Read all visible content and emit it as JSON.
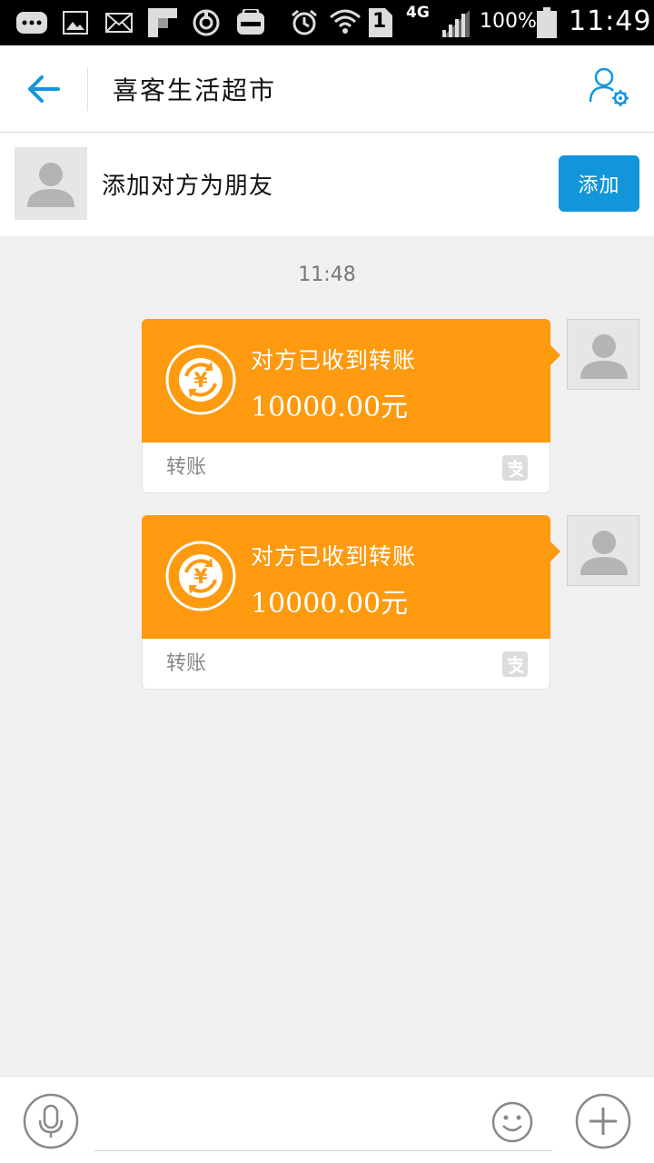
{
  "status_bar": {
    "network": "4G",
    "sim": "1",
    "battery": "100%",
    "time": "11:49",
    "icons": [
      "more-icon",
      "image-icon",
      "mail-icon",
      "flipboard-icon",
      "sync-icon",
      "galaxy-icon",
      "alarm-icon",
      "wifi-icon",
      "sim-icon",
      "signal-icon",
      "battery-icon"
    ]
  },
  "header": {
    "title": "喜客生活超市",
    "back_icon": "arrow-left-icon",
    "profile_icon": "user-settings-icon"
  },
  "add_friend": {
    "text": "添加对方为朋友",
    "button": "添加"
  },
  "chat": {
    "timestamp": "11:48",
    "messages": [
      {
        "title": "对方已收到转账",
        "amount": "10000.00元",
        "label": "转账"
      },
      {
        "title": "对方已收到转账",
        "amount": "10000.00元",
        "label": "转账"
      }
    ]
  },
  "colors": {
    "accent": "#1296db",
    "transfer_card": "#fd9a10",
    "background": "#f0f0f0"
  },
  "input_bar": {
    "placeholder": ""
  }
}
